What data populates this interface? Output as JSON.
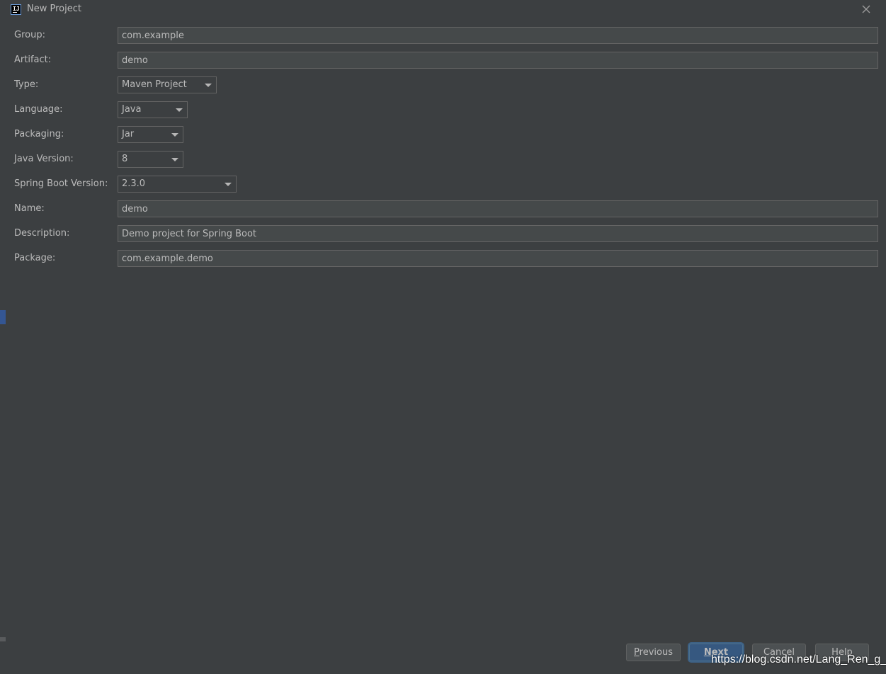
{
  "window": {
    "title": "New Project",
    "icon_text": "IJ"
  },
  "form": {
    "group": {
      "label": "Group:",
      "value": "com.example"
    },
    "artifact": {
      "label": "Artifact:",
      "value": "demo"
    },
    "type": {
      "label": "Type:",
      "value": "Maven Project"
    },
    "language": {
      "label": "Language:",
      "value": "Java"
    },
    "packaging": {
      "label": "Packaging:",
      "value": "Jar"
    },
    "java_version": {
      "label": "Java Version:",
      "value": "8"
    },
    "spring_boot_version": {
      "label": "Spring Boot Version:",
      "value": "2.3.0"
    },
    "name": {
      "label": "Name:",
      "value": "demo"
    },
    "description": {
      "label": "Description:",
      "value": "Demo project for Spring Boot"
    },
    "package": {
      "label": "Package:",
      "value": "com.example.demo"
    }
  },
  "buttons": {
    "previous": {
      "mnemonic": "P",
      "rest": "revious"
    },
    "next": {
      "mnemonic": "N",
      "rest": "ext"
    },
    "cancel": {
      "label": "Cancel"
    },
    "help": {
      "label": "Help"
    }
  },
  "watermark": "https://blog.csdn.net/Lang_Ren_g_",
  "colors": {
    "dialog_bg": "#3c3f41",
    "field_bg": "#45494a",
    "border": "#646464",
    "text": "#bbbbbb",
    "primary_button": "#365880"
  },
  "icons": {
    "app": "intellij-idea-icon",
    "close": "close-icon",
    "combo": "chevron-down-icon"
  }
}
